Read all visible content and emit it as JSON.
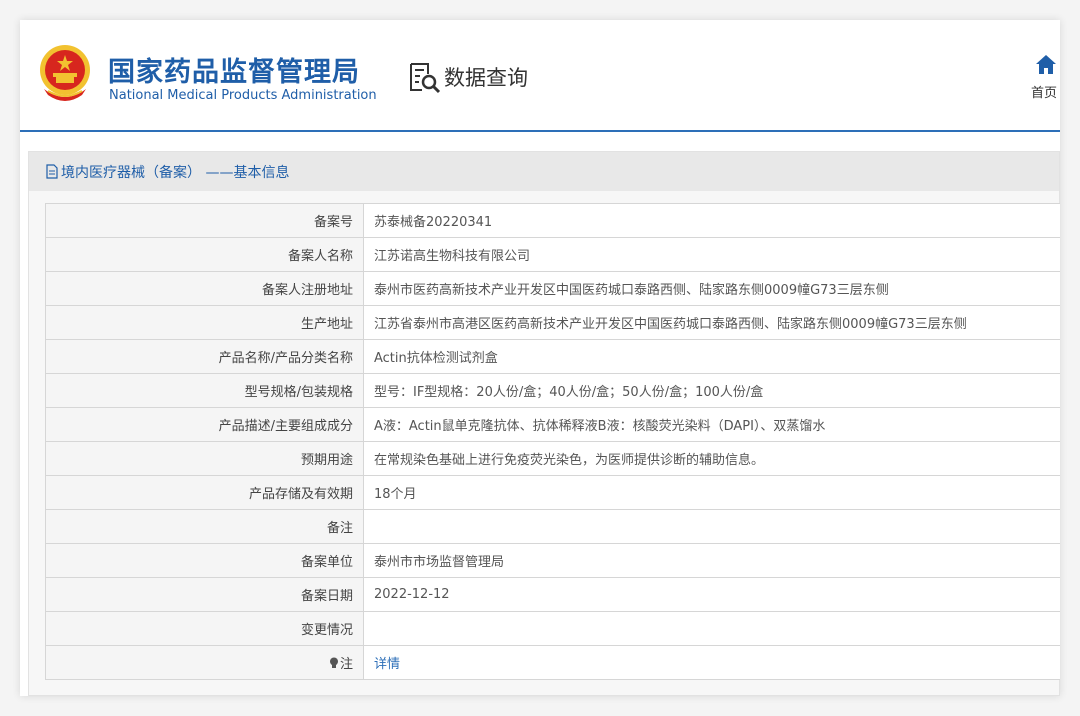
{
  "header": {
    "org_name_cn": "国家药品监督管理局",
    "org_name_en": "National Medical Products Administration",
    "query_label": "数据查询",
    "home_label": "首页"
  },
  "panel": {
    "title": "境内医疗器械（备案） ——基本信息"
  },
  "rows": [
    {
      "label": "备案号",
      "value": "苏泰械备20220341"
    },
    {
      "label": "备案人名称",
      "value": "江苏诺高生物科技有限公司"
    },
    {
      "label": "备案人注册地址",
      "value": "泰州市医药高新技术产业开发区中国医药城口泰路西侧、陆家路东侧0009幢G73三层东侧"
    },
    {
      "label": "生产地址",
      "value": "江苏省泰州市高港区医药高新技术产业开发区中国医药城口泰路西侧、陆家路东侧0009幢G73三层东侧"
    },
    {
      "label": "产品名称/产品分类名称",
      "value": "Actin抗体检测试剂盒"
    },
    {
      "label": "型号规格/包装规格",
      "value": "型号：IF型规格：20人份/盒；40人份/盒；50人份/盒；100人份/盒"
    },
    {
      "label": "产品描述/主要组成成分",
      "value": "A液：Actin鼠单克隆抗体、抗体稀释液B液：核酸荧光染料（DAPI）、双蒸馏水"
    },
    {
      "label": "预期用途",
      "value": "在常规染色基础上进行免疫荧光染色，为医师提供诊断的辅助信息。"
    },
    {
      "label": "产品存储及有效期",
      "value": "18个月"
    },
    {
      "label": "备注",
      "value": ""
    },
    {
      "label": "备案单位",
      "value": "泰州市市场监督管理局"
    },
    {
      "label": "备案日期",
      "value": "2022-12-12"
    },
    {
      "label": "变更情况",
      "value": ""
    }
  ],
  "note_row": {
    "label": "注",
    "link": "详情"
  },
  "colors": {
    "brand_blue": "#1f5ea8",
    "accent_blue": "#2d6fb8",
    "emblem_red": "#d7261e",
    "emblem_gold": "#f2c230"
  },
  "icons": {
    "emblem": "national-emblem-icon",
    "query": "document-search-icon",
    "home": "home-icon",
    "title": "document-icon",
    "note": "lightbulb-icon"
  }
}
